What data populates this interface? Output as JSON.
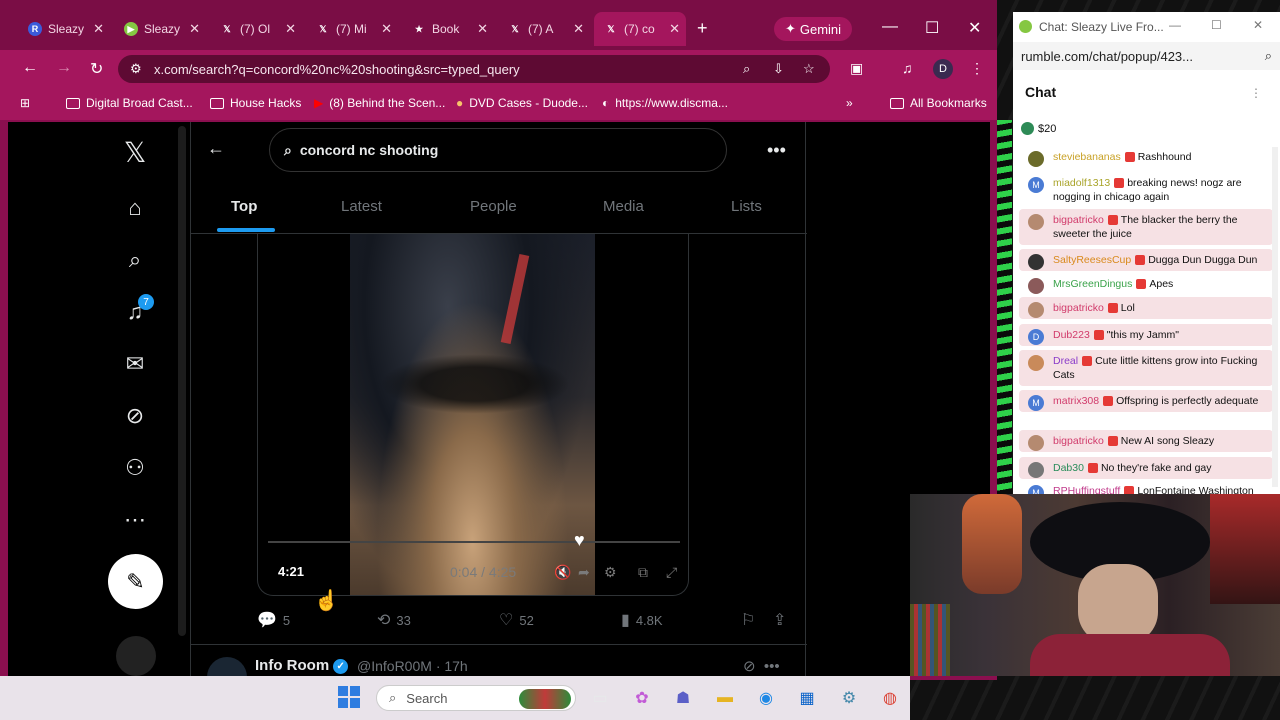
{
  "browser": {
    "tabs": [
      {
        "label": "Sleazy",
        "icon": "R"
      },
      {
        "label": "Sleazy",
        "icon": "rumble"
      },
      {
        "label": "(7) Ol",
        "icon": "X"
      },
      {
        "label": "(7) Mi",
        "icon": "X"
      },
      {
        "label": "Book",
        "icon": "star"
      },
      {
        "label": "(7) A",
        "icon": "X"
      },
      {
        "label": "(7) co",
        "icon": "X"
      }
    ],
    "new_tab": "+",
    "gemini": "Gemini",
    "url": "x.com/search?q=concord%20nc%20shooting&src=typed_query",
    "bookmarks": [
      "Digital Broad Cast...",
      "House Hacks",
      "(8) Behind the Scen...",
      "DVD Cases - Duode...",
      "https://www.discma..."
    ],
    "all_bookmarks": "All Bookmarks",
    "profile": "D"
  },
  "x": {
    "search_query": "concord nc shooting",
    "tabs": [
      "Top",
      "Latest",
      "People",
      "Media",
      "Lists"
    ],
    "notif_count": "7",
    "video": {
      "duration": "4:21",
      "progress": "0:04 / 4:25"
    },
    "actions": {
      "replies": "5",
      "reposts": "33",
      "likes": "52",
      "views": "4.8K"
    },
    "next_post": {
      "name": "Info Room",
      "handle": "@InfoR00M",
      "time": "· 17h"
    }
  },
  "chat": {
    "window_title": "Chat: Sleazy Live Fro...",
    "url": "rumble.com/chat/popup/423...",
    "header": "Chat",
    "tip": "$20",
    "messages": [
      {
        "user": "steviebananas",
        "text": "Rashhound",
        "color": "#c9a227",
        "av": "#6b6b2a",
        "hl": false
      },
      {
        "user": "miadolf1313",
        "text": "breaking news! nogz are nogging in chicago again",
        "color": "#a9a42a",
        "av": "#4a7bd4",
        "avl": "M",
        "hl": false
      },
      {
        "user": "bigpatricko",
        "text": "The blacker the berry the sweeter the juice",
        "color": "#d13b6b",
        "av": "#b58a70",
        "hl": true
      },
      {
        "user": "SaltyReesesCup",
        "text": "Dugga Dun Dugga Dun",
        "color": "#d98a1d",
        "av": "#333",
        "hl": true
      },
      {
        "user": "MrsGreenDingus",
        "text": "Apes",
        "color": "#3aa34a",
        "av": "#8b5a5a",
        "hl": false
      },
      {
        "user": "bigpatricko",
        "text": "Lol",
        "color": "#d13b6b",
        "av": "#b58a70",
        "hl": true
      },
      {
        "user": "Dub223",
        "text": "\"this my Jamm\"",
        "color": "#d13b6b",
        "av": "#4a7bd4",
        "avl": "D",
        "hl": true
      },
      {
        "user": "Dreal",
        "text": "Cute little kittens grow into Fucking Cats",
        "color": "#8a3bc9",
        "av": "#c98a5a",
        "hl": true
      },
      {
        "user": "matrix308",
        "text": "Offspring is perfectly adequate",
        "color": "#d13b6b",
        "av": "#4a7bd4",
        "avl": "M",
        "hl": true
      },
      {
        "user": "bigpatricko",
        "text": "New AI song Sleazy",
        "color": "#d13b6b",
        "av": "#b58a70",
        "hl": true
      },
      {
        "user": "Dab30",
        "text": "No they're fake and gay",
        "color": "#2a8c5a",
        "av": "#777",
        "hl": true
      },
      {
        "user": "RPHuffingstuff",
        "text": "LonFontaine Washington",
        "color": "#c13b8b",
        "av": "#4a7bd4",
        "avl": "M",
        "hl": false
      }
    ]
  },
  "taskbar": {
    "search_placeholder": "Search"
  },
  "colors": {
    "browser_frame": "#a4165d",
    "x_blue": "#1d9bf0",
    "chat_highlight": "#f6e1e4"
  }
}
